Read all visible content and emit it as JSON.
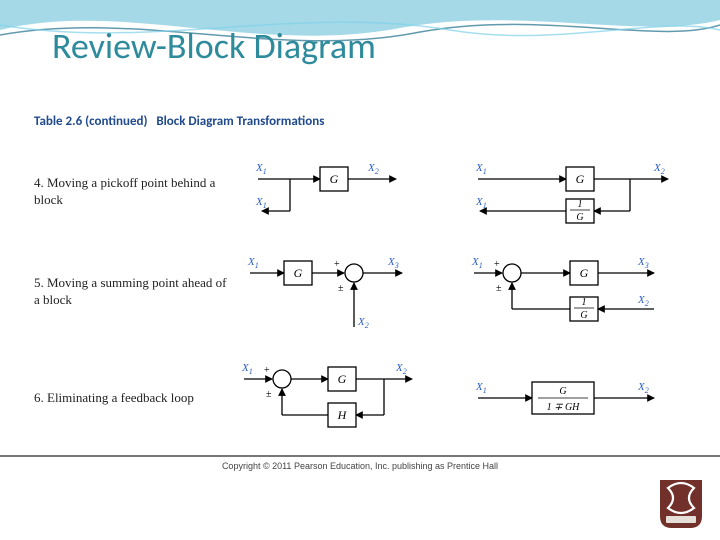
{
  "title": "Review-Block Diagram",
  "subtitle": "Table 2.6 (continued)   Block Diagram Transformations",
  "rows": [
    {
      "num": "4.",
      "desc": "Moving a pickoff point behind a block"
    },
    {
      "num": "5.",
      "desc": "Moving a summing point ahead of a block"
    },
    {
      "num": "6.",
      "desc": "Eliminating a feedback loop"
    }
  ],
  "signals": {
    "x1": "X",
    "x1s": "1",
    "x2": "X",
    "x2s": "2",
    "x3": "X",
    "x3s": "3"
  },
  "blocks": {
    "G": "G",
    "H": "H",
    "invG_num": "1",
    "invG_den": "G",
    "cl_num": "G",
    "cl_den": "1 ∓ GH"
  },
  "ops": {
    "plus": "+",
    "pm": "±"
  },
  "copyright": "Copyright © 2011 Pearson Education, Inc. publishing as Prentice Hall"
}
